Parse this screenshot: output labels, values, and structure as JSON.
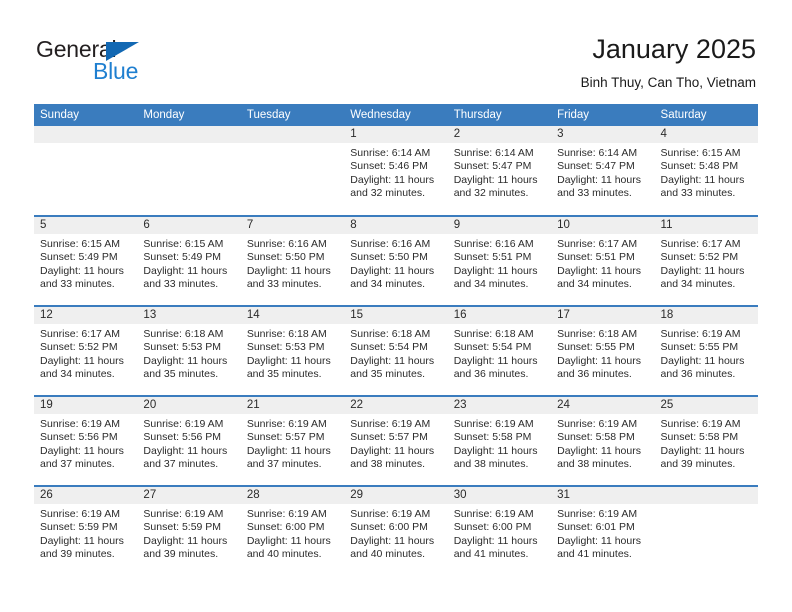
{
  "brand": {
    "name_part1": "General",
    "name_part2": "Blue",
    "triangle_icon": "triangle-icon",
    "color_dark": "#231f20",
    "color_blue": "#1f7fd0"
  },
  "header": {
    "title": "January 2025",
    "subtitle": "Binh Thuy, Can Tho, Vietnam"
  },
  "theme": {
    "header_blue": "#3a7cbe",
    "daynum_band": "#efefef",
    "text": "#2b2b2b"
  },
  "calendar": {
    "weekday_headers": [
      "Sunday",
      "Monday",
      "Tuesday",
      "Wednesday",
      "Thursday",
      "Friday",
      "Saturday"
    ],
    "weeks": [
      [
        {
          "day": "",
          "sunrise": "",
          "sunset": "",
          "daylight_line1": "",
          "daylight_line2": ""
        },
        {
          "day": "",
          "sunrise": "",
          "sunset": "",
          "daylight_line1": "",
          "daylight_line2": ""
        },
        {
          "day": "",
          "sunrise": "",
          "sunset": "",
          "daylight_line1": "",
          "daylight_line2": ""
        },
        {
          "day": "1",
          "sunrise": "Sunrise: 6:14 AM",
          "sunset": "Sunset: 5:46 PM",
          "daylight_line1": "Daylight: 11 hours",
          "daylight_line2": "and 32 minutes."
        },
        {
          "day": "2",
          "sunrise": "Sunrise: 6:14 AM",
          "sunset": "Sunset: 5:47 PM",
          "daylight_line1": "Daylight: 11 hours",
          "daylight_line2": "and 32 minutes."
        },
        {
          "day": "3",
          "sunrise": "Sunrise: 6:14 AM",
          "sunset": "Sunset: 5:47 PM",
          "daylight_line1": "Daylight: 11 hours",
          "daylight_line2": "and 33 minutes."
        },
        {
          "day": "4",
          "sunrise": "Sunrise: 6:15 AM",
          "sunset": "Sunset: 5:48 PM",
          "daylight_line1": "Daylight: 11 hours",
          "daylight_line2": "and 33 minutes."
        }
      ],
      [
        {
          "day": "5",
          "sunrise": "Sunrise: 6:15 AM",
          "sunset": "Sunset: 5:49 PM",
          "daylight_line1": "Daylight: 11 hours",
          "daylight_line2": "and 33 minutes."
        },
        {
          "day": "6",
          "sunrise": "Sunrise: 6:15 AM",
          "sunset": "Sunset: 5:49 PM",
          "daylight_line1": "Daylight: 11 hours",
          "daylight_line2": "and 33 minutes."
        },
        {
          "day": "7",
          "sunrise": "Sunrise: 6:16 AM",
          "sunset": "Sunset: 5:50 PM",
          "daylight_line1": "Daylight: 11 hours",
          "daylight_line2": "and 33 minutes."
        },
        {
          "day": "8",
          "sunrise": "Sunrise: 6:16 AM",
          "sunset": "Sunset: 5:50 PM",
          "daylight_line1": "Daylight: 11 hours",
          "daylight_line2": "and 34 minutes."
        },
        {
          "day": "9",
          "sunrise": "Sunrise: 6:16 AM",
          "sunset": "Sunset: 5:51 PM",
          "daylight_line1": "Daylight: 11 hours",
          "daylight_line2": "and 34 minutes."
        },
        {
          "day": "10",
          "sunrise": "Sunrise: 6:17 AM",
          "sunset": "Sunset: 5:51 PM",
          "daylight_line1": "Daylight: 11 hours",
          "daylight_line2": "and 34 minutes."
        },
        {
          "day": "11",
          "sunrise": "Sunrise: 6:17 AM",
          "sunset": "Sunset: 5:52 PM",
          "daylight_line1": "Daylight: 11 hours",
          "daylight_line2": "and 34 minutes."
        }
      ],
      [
        {
          "day": "12",
          "sunrise": "Sunrise: 6:17 AM",
          "sunset": "Sunset: 5:52 PM",
          "daylight_line1": "Daylight: 11 hours",
          "daylight_line2": "and 34 minutes."
        },
        {
          "day": "13",
          "sunrise": "Sunrise: 6:18 AM",
          "sunset": "Sunset: 5:53 PM",
          "daylight_line1": "Daylight: 11 hours",
          "daylight_line2": "and 35 minutes."
        },
        {
          "day": "14",
          "sunrise": "Sunrise: 6:18 AM",
          "sunset": "Sunset: 5:53 PM",
          "daylight_line1": "Daylight: 11 hours",
          "daylight_line2": "and 35 minutes."
        },
        {
          "day": "15",
          "sunrise": "Sunrise: 6:18 AM",
          "sunset": "Sunset: 5:54 PM",
          "daylight_line1": "Daylight: 11 hours",
          "daylight_line2": "and 35 minutes."
        },
        {
          "day": "16",
          "sunrise": "Sunrise: 6:18 AM",
          "sunset": "Sunset: 5:54 PM",
          "daylight_line1": "Daylight: 11 hours",
          "daylight_line2": "and 36 minutes."
        },
        {
          "day": "17",
          "sunrise": "Sunrise: 6:18 AM",
          "sunset": "Sunset: 5:55 PM",
          "daylight_line1": "Daylight: 11 hours",
          "daylight_line2": "and 36 minutes."
        },
        {
          "day": "18",
          "sunrise": "Sunrise: 6:19 AM",
          "sunset": "Sunset: 5:55 PM",
          "daylight_line1": "Daylight: 11 hours",
          "daylight_line2": "and 36 minutes."
        }
      ],
      [
        {
          "day": "19",
          "sunrise": "Sunrise: 6:19 AM",
          "sunset": "Sunset: 5:56 PM",
          "daylight_line1": "Daylight: 11 hours",
          "daylight_line2": "and 37 minutes."
        },
        {
          "day": "20",
          "sunrise": "Sunrise: 6:19 AM",
          "sunset": "Sunset: 5:56 PM",
          "daylight_line1": "Daylight: 11 hours",
          "daylight_line2": "and 37 minutes."
        },
        {
          "day": "21",
          "sunrise": "Sunrise: 6:19 AM",
          "sunset": "Sunset: 5:57 PM",
          "daylight_line1": "Daylight: 11 hours",
          "daylight_line2": "and 37 minutes."
        },
        {
          "day": "22",
          "sunrise": "Sunrise: 6:19 AM",
          "sunset": "Sunset: 5:57 PM",
          "daylight_line1": "Daylight: 11 hours",
          "daylight_line2": "and 38 minutes."
        },
        {
          "day": "23",
          "sunrise": "Sunrise: 6:19 AM",
          "sunset": "Sunset: 5:58 PM",
          "daylight_line1": "Daylight: 11 hours",
          "daylight_line2": "and 38 minutes."
        },
        {
          "day": "24",
          "sunrise": "Sunrise: 6:19 AM",
          "sunset": "Sunset: 5:58 PM",
          "daylight_line1": "Daylight: 11 hours",
          "daylight_line2": "and 38 minutes."
        },
        {
          "day": "25",
          "sunrise": "Sunrise: 6:19 AM",
          "sunset": "Sunset: 5:58 PM",
          "daylight_line1": "Daylight: 11 hours",
          "daylight_line2": "and 39 minutes."
        }
      ],
      [
        {
          "day": "26",
          "sunrise": "Sunrise: 6:19 AM",
          "sunset": "Sunset: 5:59 PM",
          "daylight_line1": "Daylight: 11 hours",
          "daylight_line2": "and 39 minutes."
        },
        {
          "day": "27",
          "sunrise": "Sunrise: 6:19 AM",
          "sunset": "Sunset: 5:59 PM",
          "daylight_line1": "Daylight: 11 hours",
          "daylight_line2": "and 39 minutes."
        },
        {
          "day": "28",
          "sunrise": "Sunrise: 6:19 AM",
          "sunset": "Sunset: 6:00 PM",
          "daylight_line1": "Daylight: 11 hours",
          "daylight_line2": "and 40 minutes."
        },
        {
          "day": "29",
          "sunrise": "Sunrise: 6:19 AM",
          "sunset": "Sunset: 6:00 PM",
          "daylight_line1": "Daylight: 11 hours",
          "daylight_line2": "and 40 minutes."
        },
        {
          "day": "30",
          "sunrise": "Sunrise: 6:19 AM",
          "sunset": "Sunset: 6:00 PM",
          "daylight_line1": "Daylight: 11 hours",
          "daylight_line2": "and 41 minutes."
        },
        {
          "day": "31",
          "sunrise": "Sunrise: 6:19 AM",
          "sunset": "Sunset: 6:01 PM",
          "daylight_line1": "Daylight: 11 hours",
          "daylight_line2": "and 41 minutes."
        },
        {
          "day": "",
          "sunrise": "",
          "sunset": "",
          "daylight_line1": "",
          "daylight_line2": ""
        }
      ]
    ]
  }
}
